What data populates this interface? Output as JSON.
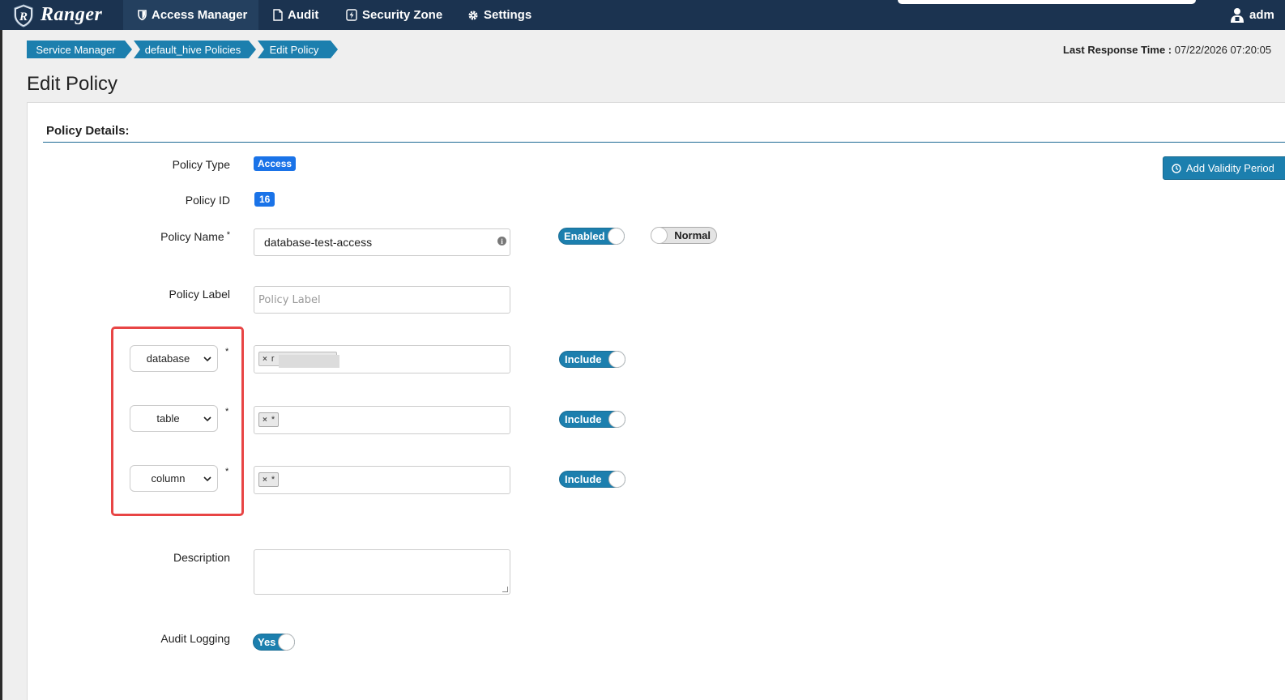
{
  "nav": {
    "brand": "Ranger",
    "items": [
      {
        "label": "Access Manager",
        "icon": "shield-icon"
      },
      {
        "label": "Audit",
        "icon": "file-icon"
      },
      {
        "label": "Security Zone",
        "icon": "bolt-icon"
      },
      {
        "label": "Settings",
        "icon": "gear-icon"
      }
    ],
    "user": "adm"
  },
  "breadcrumb": [
    "Service Manager",
    "default_hive Policies",
    "Edit Policy"
  ],
  "last_response": {
    "label": "Last Response Time :",
    "value": "07/22/2026 07:20:05"
  },
  "page_title": "Edit Policy",
  "section_title": "Policy Details:",
  "form": {
    "policy_type_label": "Policy Type",
    "policy_type_value": "Access",
    "policy_id_label": "Policy ID",
    "policy_id_value": "16",
    "policy_name_label": "Policy Name",
    "policy_name_value": "database-test-access",
    "enabled_toggle": "Enabled",
    "normal_toggle": "Normal",
    "policy_label_label": "Policy Label",
    "policy_label_placeholder": "Policy Label",
    "add_validity_label": "Add Validity Period",
    "resources": [
      {
        "type": "database",
        "value": "r",
        "include": "Include"
      },
      {
        "type": "table",
        "value": "*",
        "include": "Include"
      },
      {
        "type": "column",
        "value": "*",
        "include": "Include"
      }
    ],
    "required_mark": "*",
    "tag_remove": "×",
    "description_label": "Description",
    "audit_logging_label": "Audit Logging",
    "audit_logging_value": "Yes"
  },
  "colors": {
    "navbar": "#1b3350",
    "accent": "#1c7fae",
    "highlight": "#e84545",
    "badge": "#1a73e8"
  }
}
